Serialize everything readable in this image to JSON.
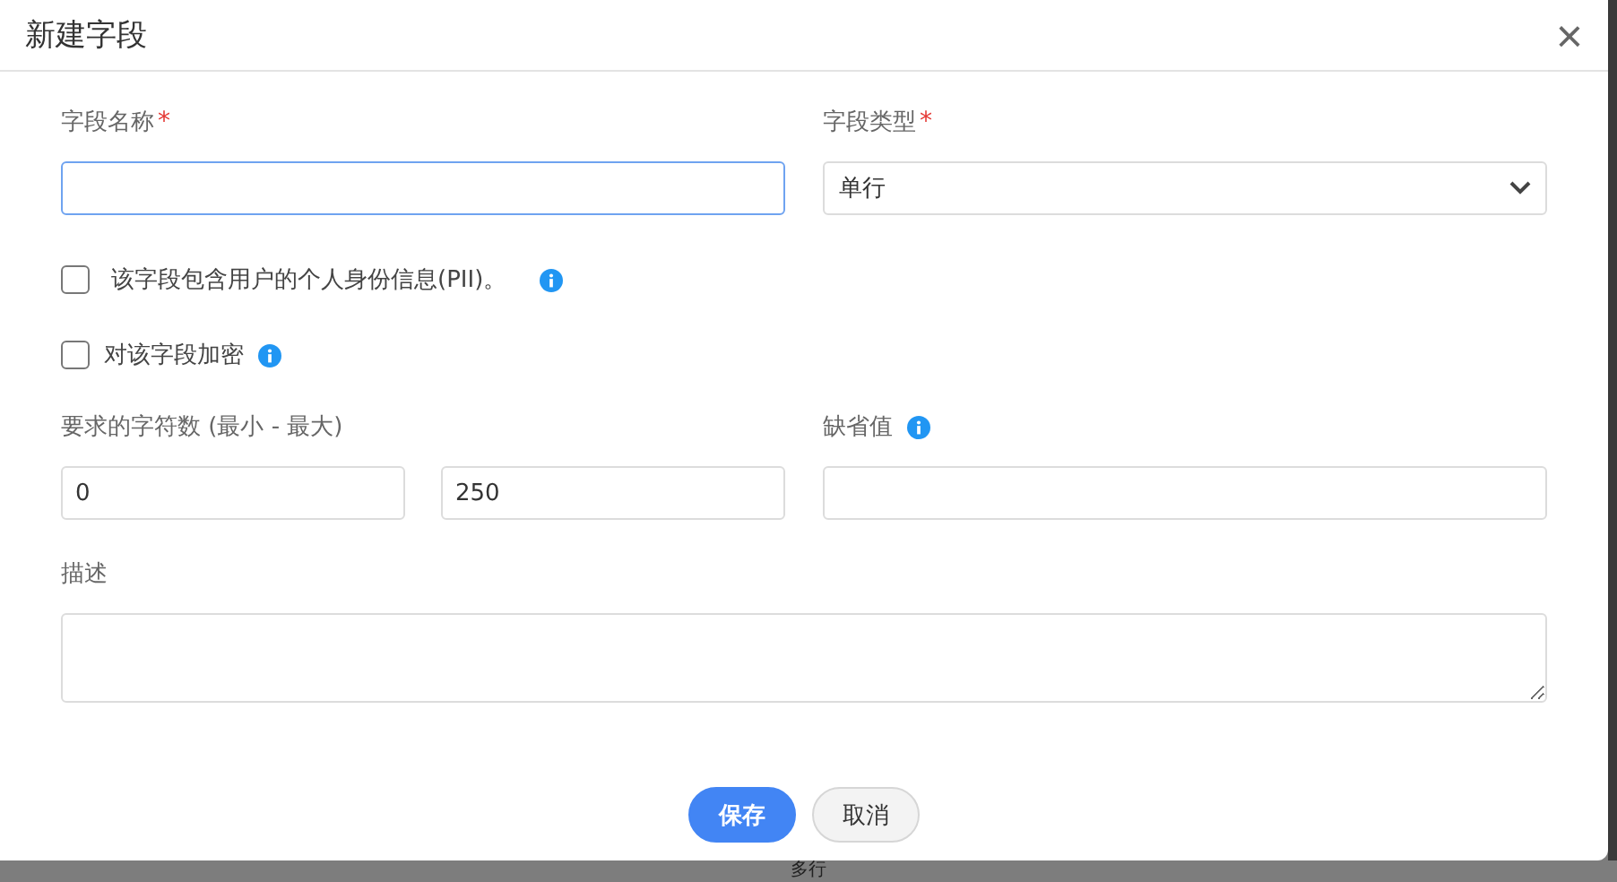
{
  "dialog": {
    "title": "新建字段",
    "close": "×"
  },
  "field_name": {
    "label": "字段名称",
    "required_mark": "*",
    "focused": true
  },
  "field_type": {
    "label": "字段类型",
    "required_mark": "*",
    "value": "单行"
  },
  "checkboxes": [
    {
      "label": "该字段包含用户的个人身份信息(PII)。",
      "checked": false,
      "info": true
    },
    {
      "label": "对该字段加密",
      "checked": false,
      "info": true
    }
  ],
  "length": {
    "label": "要求的字符数 (最小 - 最大)",
    "min": "0",
    "max": "250"
  },
  "default_value": {
    "label": "缺省值",
    "info": true
  },
  "description": {
    "label": "描述"
  },
  "buttons": [
    {
      "label": "保存",
      "kind": "primary"
    },
    {
      "label": "取消",
      "kind": "secondary"
    }
  ],
  "backdrop_text": "多行"
}
